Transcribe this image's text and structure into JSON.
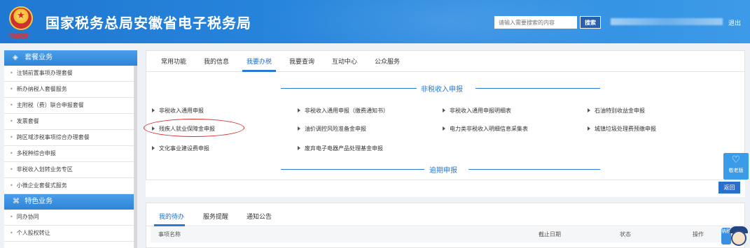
{
  "header": {
    "title": "国家税务总局安徽省电子税务局",
    "emblem_caption": "中国税务",
    "search_placeholder": "请输入需要搜索的内容",
    "search_button": "搜索",
    "logout": "退出"
  },
  "sidebar": {
    "group1_title": "套餐业务",
    "group1_items": [
      "注销前置事项办理套餐",
      "新办纳税人套餐服务",
      "主附税（费）联合申报套餐",
      "发票套餐",
      "跨区域涉税事项综合办理套餐",
      "多税种综合申报",
      "非税收入划转业务专区",
      "小微企业套餐式服务"
    ],
    "group2_title": "特色业务",
    "group2_items": [
      "同办协同",
      "个人股权转让"
    ]
  },
  "tabs": [
    "常用功能",
    "我的信息",
    "我要办税",
    "我要查询",
    "互动中心",
    "公众服务"
  ],
  "sections": {
    "nontax_title": "非税收入申报",
    "overdue_title": "逾期申报"
  },
  "links": {
    "row1": [
      "非税收入通用申报",
      "非税收入通用申报（缴费通知书）",
      "非税收入通用申报明细表",
      "石油特别收益金申报"
    ],
    "row2": [
      "残疾人就业保障金申报",
      "油价调控风险准备金申报",
      "电力类非税收入明细信息采集表",
      "城镇垃圾处理费预缴申报"
    ],
    "row3": [
      "文化事业建设费申报",
      "废弃电子电器产品处理基金申报"
    ]
  },
  "back_button": "返回",
  "bottom_tabs": [
    "我的待办",
    "服务提醒",
    "通知公告"
  ],
  "table_headers": [
    "事项名称",
    "截止日期",
    "状态",
    "操作"
  ],
  "float_elderly_label": "敬老版",
  "mascot_text": "纳税"
}
